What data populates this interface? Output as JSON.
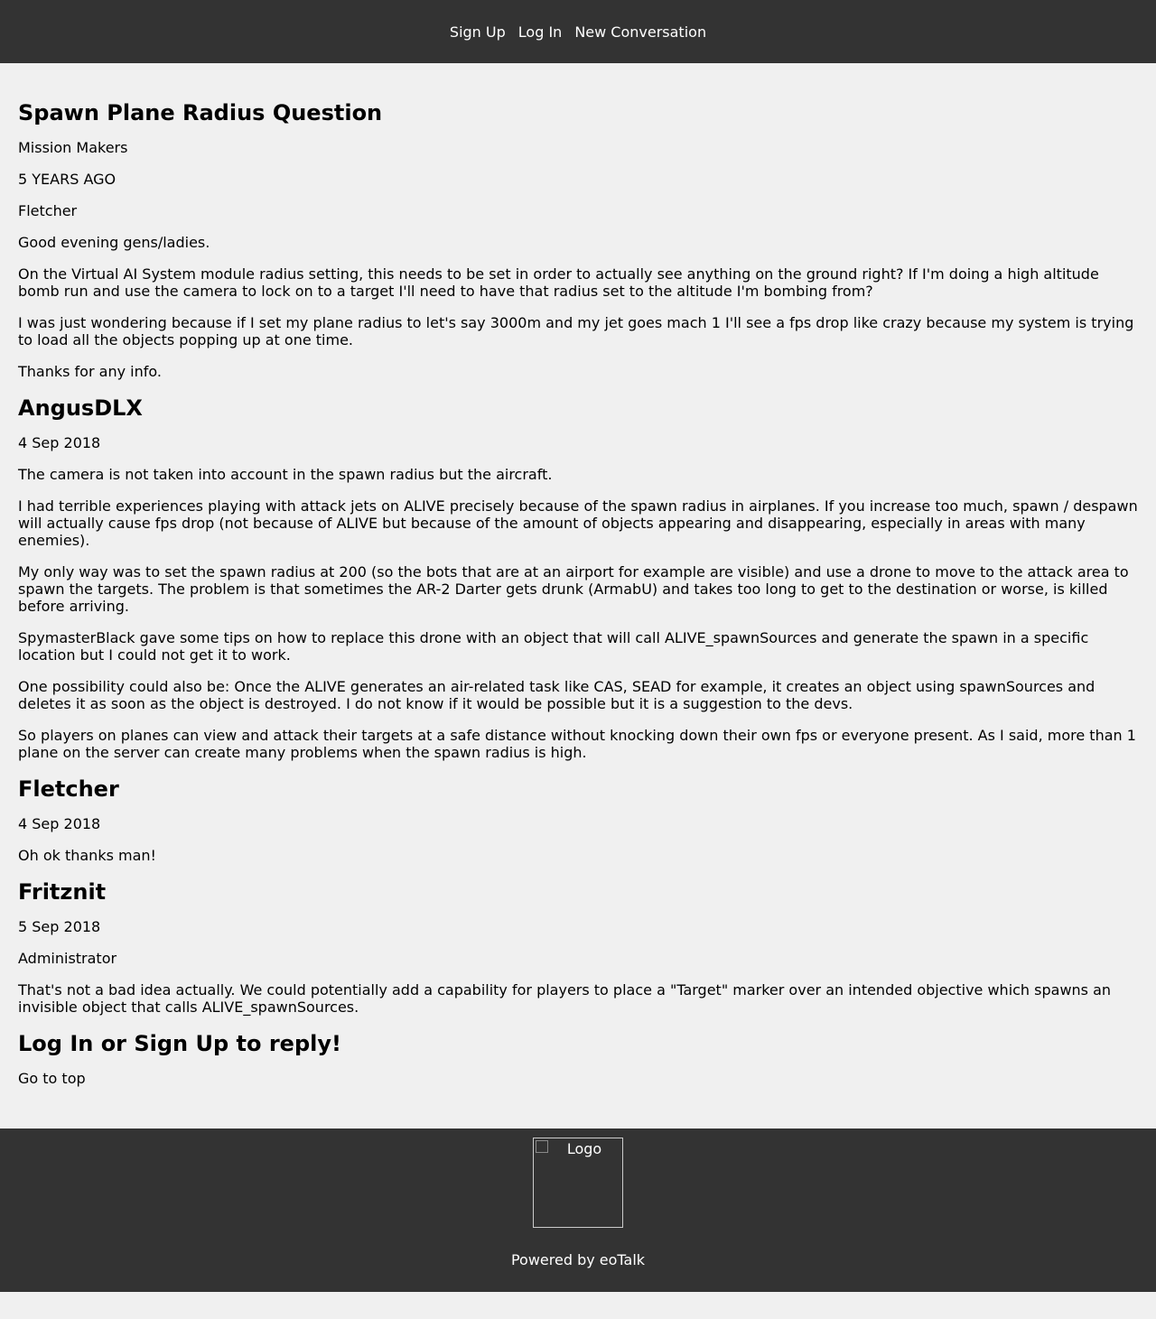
{
  "nav": {
    "sign_up": "Sign Up",
    "log_in": "Log In",
    "new_conversation": "New Conversation"
  },
  "thread": {
    "title": "Spawn Plane Radius Question",
    "category": "Mission Makers",
    "age": "5 YEARS AGO",
    "author": "Fletcher",
    "body": [
      "Good evening gens/ladies.",
      "On the Virtual AI System module radius setting, this needs to be set in order to actually see anything on the ground right? If I'm doing a high altitude bomb run and use the camera to lock on to a target I'll need to have that radius set to the altitude I'm bombing from?",
      "I was just wondering because if I set my plane radius to let's say 3000m and my jet goes mach 1 I'll see a fps drop like crazy because my system is trying to load all the objects popping up at one time.",
      "Thanks for any info."
    ]
  },
  "replies": [
    {
      "author": "AngusDLX",
      "date": "4 Sep 2018",
      "body": [
        "The camera is not taken into account in the spawn radius but the aircraft.",
        "I had terrible experiences playing with attack jets on ALIVE precisely because of the spawn radius in airplanes. If you increase too much, spawn / despawn will actually cause fps drop (not because of ALIVE but because of the amount of objects appearing and disappearing, especially in areas with many enemies).",
        "My only way was to set the spawn radius at 200 (so the bots that are at an airport for example are visible) and use a drone to move to the attack area to spawn the targets. The problem is that sometimes the AR-2 Darter gets drunk (ArmabU) and takes too long to get to the destination or worse, is killed before arriving.",
        "SpymasterBlack gave some tips on how to replace this drone with an object that will call ALIVE_spawnSources and generate the spawn in a specific location but I could not get it to work.",
        "One possibility could also be: Once the ALIVE generates an air-related task like CAS, SEAD for example, it creates an object using spawnSources and deletes it as soon as the object is destroyed. I do not know if it would be possible but it is a suggestion to the devs.",
        "So players on planes can view and attack their targets at a safe distance without knocking down their own fps or everyone present. As I said, more than 1 plane on the server can create many problems when the spawn radius is high."
      ]
    },
    {
      "author": "Fletcher",
      "date": "4 Sep 2018",
      "body": [
        "Oh ok thanks man!"
      ]
    },
    {
      "author": "Fritznit",
      "date": "5 Sep 2018",
      "role": "Administrator",
      "body": [
        "That's not a bad idea actually. We could potentially add a capability for players to place a \"Target\" marker over an intended objective which spawns an invisible object that calls ALIVE_spawnSources."
      ]
    }
  ],
  "reply_prompt": "Log In or Sign Up to reply!",
  "go_to_top": "Go to top",
  "footer": {
    "logo_alt": "Logo",
    "powered_by": "Powered by eoTalk"
  },
  "colors": {
    "header_bg": "#333333",
    "page_bg": "#f0f0f0",
    "footer_bg": "#333333"
  }
}
